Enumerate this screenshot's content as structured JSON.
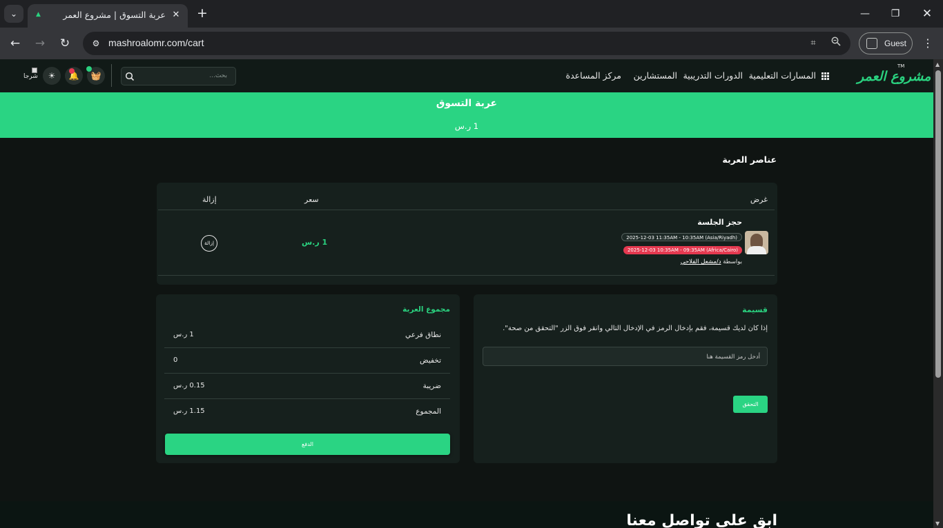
{
  "browser": {
    "tab_title": "عربة التسوق | مشروع العمر",
    "url": "mashroalomr.com/cart",
    "profile_label": "Guest"
  },
  "site": {
    "logo_text": "مشروع العمر",
    "logo_tm": "TM",
    "nav": {
      "paths": "المسارات التعليمية",
      "courses": "الدورات التدريبية",
      "consultants": "المستشارين",
      "help": "مركز المساعدة"
    },
    "search_placeholder": "بحث...",
    "avatar_alt": "شرجا"
  },
  "hero": {
    "title": "عربة التسوق",
    "total": "1 ر.س"
  },
  "cart": {
    "section_title": "عناصر العربة",
    "columns": {
      "offer": "غرض",
      "price": "سعر",
      "remove": "إزالة"
    },
    "item": {
      "name": "حجز الجلسة",
      "time_riyadh": "2025-12-03 11:35AM - 10:35AM (Asia/Riyadh)",
      "time_cairo": "2025-12-03 10:35AM - 09:35AM (Africa/Cairo)",
      "by_label": "بواسطة",
      "by_name": "د/مشعل الفلاحي",
      "price": "1 ر.س",
      "remove_label": "إزالة"
    }
  },
  "coupon": {
    "title": "قسيمة",
    "description": "إذا كان لديك قسيمة، فقم بإدخال الرمز في الإدخال التالي وانقر فوق الزر \"التحقق من صحة\".",
    "placeholder": "أدخل رمز القسيمة هنا",
    "verify_label": "التحقق"
  },
  "summary": {
    "title": "مجموع العربة",
    "rows": [
      {
        "label": "نطاق فرعي",
        "value": "1 ر.س"
      },
      {
        "label": "تخفيض",
        "value": "0"
      },
      {
        "label": "ضريبة",
        "value": "0.15 ر.س"
      },
      {
        "label": "المجموع",
        "value": "1.15 ر.س"
      }
    ],
    "pay_label": "الدفع"
  },
  "footer": {
    "title": "ابق على تواصل معنا"
  },
  "colors": {
    "accent": "#2ad483",
    "danger": "#e53950",
    "page_bg": "#0f1412",
    "card_bg": "#16201d"
  }
}
